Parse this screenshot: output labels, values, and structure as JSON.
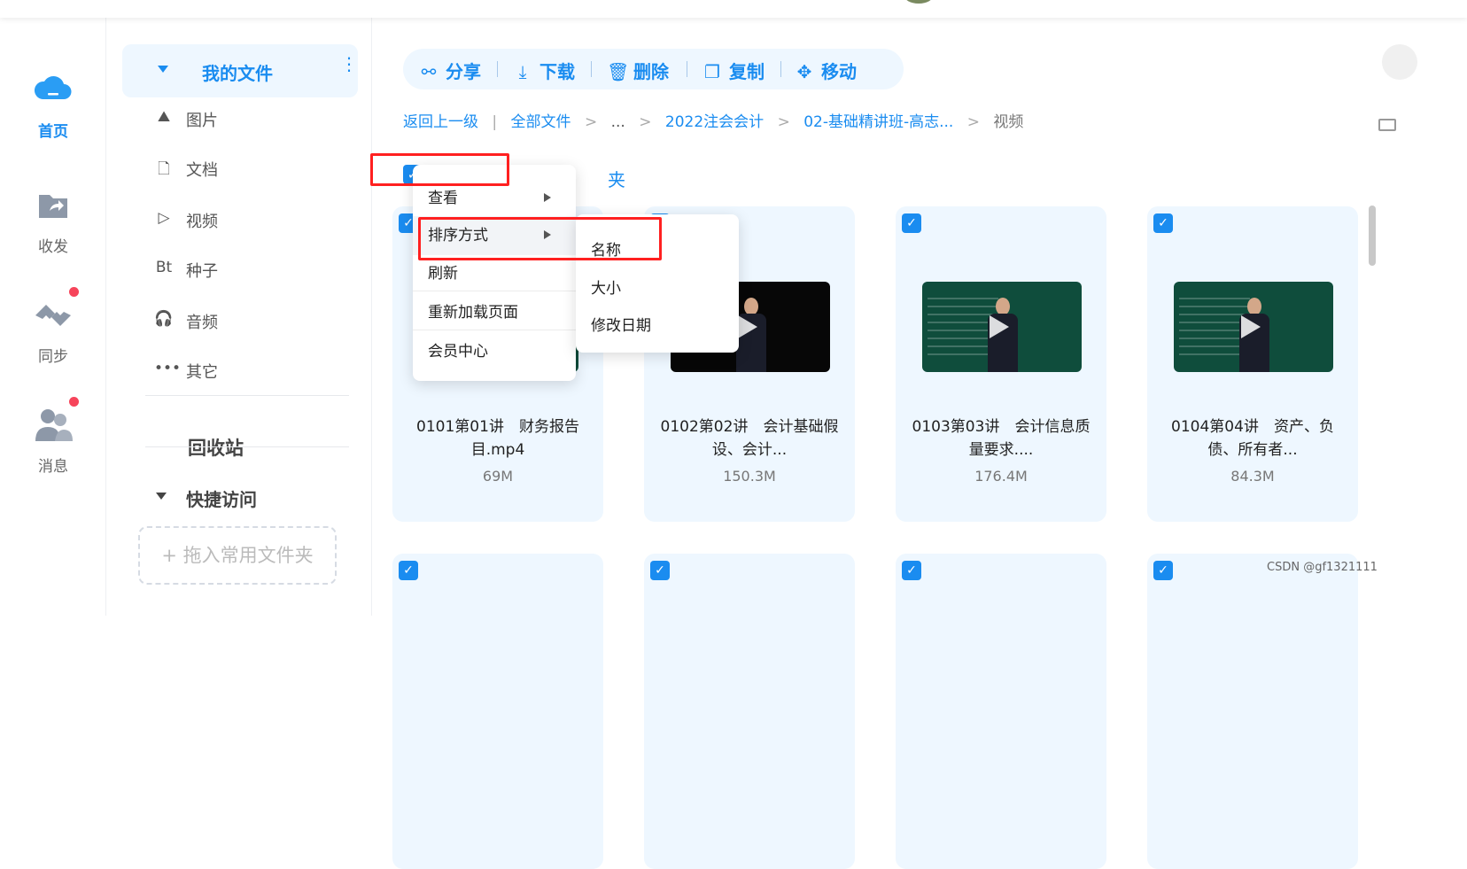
{
  "rail": [
    {
      "label": "首页",
      "icon": "cloud-icon",
      "active": true
    },
    {
      "label": "收发",
      "icon": "share-folder-icon",
      "active": false
    },
    {
      "label": "同步",
      "icon": "sync-icon",
      "active": false,
      "badge": true
    },
    {
      "label": "消息",
      "icon": "users-icon",
      "active": false,
      "badge": true
    }
  ],
  "sidebar": {
    "my_files": "我的文件",
    "categories": [
      {
        "label": "图片",
        "icon": "image-icon",
        "glyph": "⛰"
      },
      {
        "label": "文档",
        "icon": "document-icon",
        "glyph": "🗋"
      },
      {
        "label": "视频",
        "icon": "video-icon",
        "glyph": "▷"
      },
      {
        "label": "种子",
        "icon": "torrent-icon",
        "glyph": "Bt"
      },
      {
        "label": "音频",
        "icon": "headphones-icon",
        "glyph": "🎧"
      },
      {
        "label": "其它",
        "icon": "more-icon",
        "glyph": "•••"
      }
    ],
    "recycle": "回收站",
    "quick_access": "快捷访问",
    "drop_zone": "+ 拖入常用文件夹"
  },
  "toolbar": {
    "share": "分享",
    "download": "下载",
    "delete": "删除",
    "copy": "复制",
    "move": "移动"
  },
  "breadcrumb": {
    "back": "返回上一级",
    "sep": "|",
    "all": "全部文件",
    "ellipsis": "...",
    "folder1": "2022注会会计",
    "folder2": "02-基础精讲班-高志...",
    "current": "视频",
    "gt": ">"
  },
  "partial_text": "夹",
  "context_menu": {
    "view": "查看",
    "sort": "排序方式",
    "refresh": "刷新",
    "reload": "重新加载页面",
    "member": "会员中心"
  },
  "sort_submenu": {
    "name": "名称",
    "size": "大小",
    "date": "修改日期"
  },
  "files": [
    {
      "name": "0101第01讲　财务报告目.mp4",
      "size": "69M"
    },
    {
      "name": "0102第02讲　会计基础假设、会计...",
      "size": "150.3M"
    },
    {
      "name": "0103第03讲　会计信息质量要求....",
      "size": "176.4M"
    },
    {
      "name": "0104第04讲　资产、负债、所有者...",
      "size": "84.3M"
    }
  ],
  "check_mark": "✓",
  "watermark": "CSDN @gf1321111",
  "colors": {
    "accent": "#1a8cf0",
    "highlight_box": "#ff2020",
    "badge": "#f6445a"
  }
}
